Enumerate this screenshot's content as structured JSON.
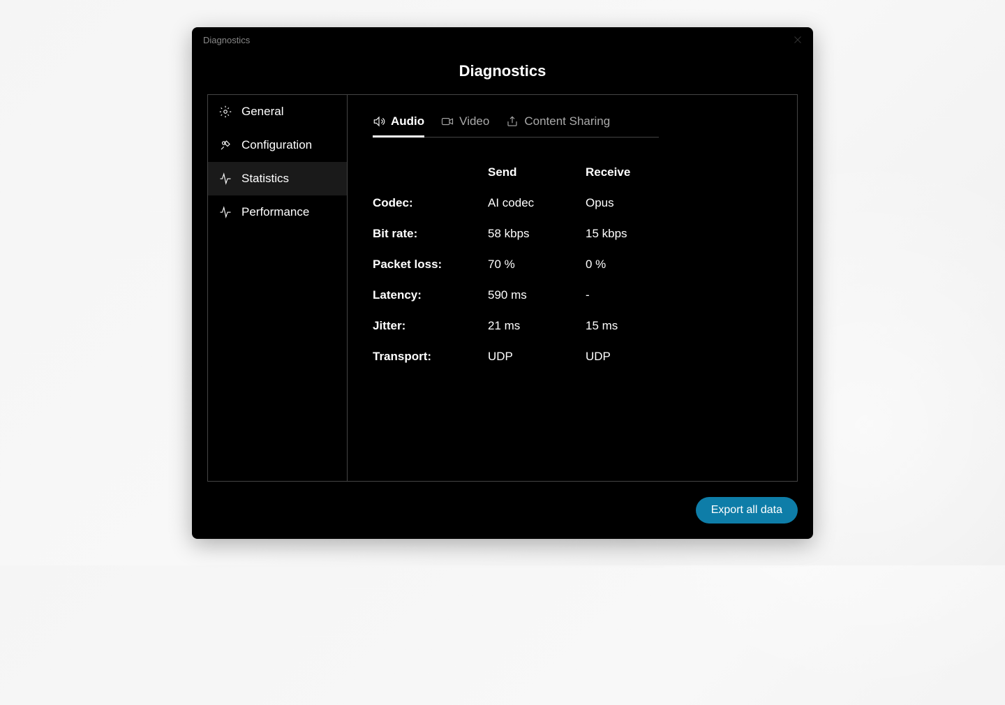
{
  "titlebar": {
    "title": "Diagnostics"
  },
  "header": {
    "title": "Diagnostics"
  },
  "sidebar": {
    "items": [
      {
        "label": "General"
      },
      {
        "label": "Configuration"
      },
      {
        "label": "Statistics"
      },
      {
        "label": "Performance"
      }
    ]
  },
  "tabs": {
    "items": [
      {
        "label": "Audio"
      },
      {
        "label": "Video"
      },
      {
        "label": "Content Sharing"
      }
    ]
  },
  "stats": {
    "headers": {
      "send": "Send",
      "receive": "Receive"
    },
    "rows": [
      {
        "label": "Codec:",
        "send": "AI codec",
        "receive": "Opus"
      },
      {
        "label": "Bit rate:",
        "send": "58 kbps",
        "receive": "15 kbps"
      },
      {
        "label": "Packet loss:",
        "send": "70 %",
        "receive": "0 %"
      },
      {
        "label": "Latency:",
        "send": "590 ms",
        "receive": "-"
      },
      {
        "label": "Jitter:",
        "send": "21 ms",
        "receive": "15 ms"
      },
      {
        "label": "Transport:",
        "send": "UDP",
        "receive": "UDP"
      }
    ]
  },
  "footer": {
    "export_button": "Export all data"
  }
}
